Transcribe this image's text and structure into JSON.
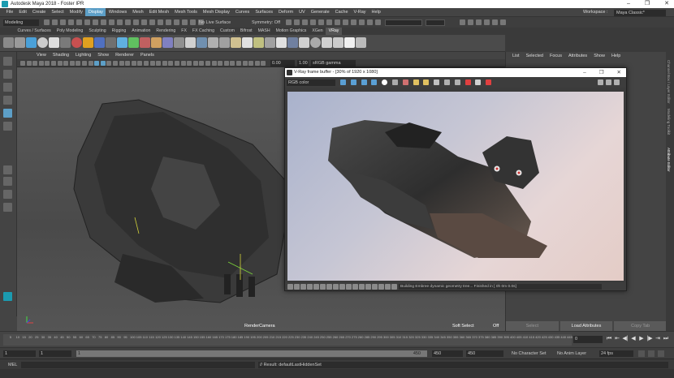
{
  "window": {
    "title": "Autodesk Maya 2018 - Foster IPR",
    "controls": [
      "–",
      "❐",
      "✕"
    ]
  },
  "menu": {
    "items": [
      "File",
      "Edit",
      "Create",
      "Select",
      "Modify",
      "Display",
      "Windows",
      "Mesh",
      "Edit Mesh",
      "Mesh Tools",
      "Mesh Display",
      "Curves",
      "Surfaces",
      "Deform",
      "UV",
      "Generate",
      "Cache",
      "V-Ray",
      "Help"
    ],
    "highlighted_index": 5,
    "workspace_label": "Workspace :",
    "workspace_value": "Maya Classic*"
  },
  "statusline": {
    "mode": "Modeling",
    "live_surface": "No Live Surface",
    "symmetry": "Symmetry: Off"
  },
  "shelf": {
    "tabs": [
      "Curves / Surfaces",
      "Poly Modeling",
      "Sculpting",
      "Rigging",
      "Animation",
      "Rendering",
      "FX",
      "FX Caching",
      "Custom",
      "Bifrost",
      "MASH",
      "Motion Graphics",
      "XGen",
      "VRay"
    ],
    "active_index": 13,
    "icon_colors": [
      "#8a8a8a",
      "#9a9a9a",
      "#4aa0d8",
      "#cccccc",
      "#dddddd",
      "#7a7a7a",
      "#c85050",
      "#e0a020",
      "#5070c0",
      "#707070",
      "#60b0e0",
      "#60c060",
      "#c06060",
      "#d0a060",
      "#8080c0",
      "#909090",
      "#d0d0d0",
      "#7090b0",
      "#b0b0b0",
      "#a0a0a0",
      "#d0c090",
      "#e0e0e0",
      "#c0c080",
      "#a0a0a0",
      "#e0e0e0",
      "#7080a0",
      "#d0d0d0",
      "#aaaaaa",
      "#d0d0d0",
      "#cccccc",
      "#f0f0f0",
      "#bbbbbb"
    ]
  },
  "panel": {
    "menu": [
      "View",
      "Shading",
      "Lighting",
      "Show",
      "Renderer",
      "Panels"
    ],
    "near_clip": "0.00",
    "gamma_value": "1.00",
    "color_space": "sRGB gamma",
    "camera_label": "RenderCamera"
  },
  "attribute_editor": {
    "menu": [
      "List",
      "Selected",
      "Focus",
      "Attributes",
      "Show",
      "Help"
    ],
    "buttons": [
      "Select",
      "Load Attributes",
      "Copy Tab"
    ],
    "side_tabs": [
      "Channel Box / Layer Editor",
      "Modeling Toolkit",
      "Attribute Editor"
    ]
  },
  "vray_fb": {
    "title": "V-Ray frame buffer - [30% of 1920 x 1080]",
    "channel": "RGB color",
    "status": "Building Embree dynamic geometry tree... Finished in [ 0h 0m 0.0s]",
    "tool_icon_colors": [
      "#5a9fd4",
      "#5a9fd4",
      "#5a9fd4",
      "#5a9fd4",
      "#ffffff",
      "#aaaaaa",
      "#d07070",
      "#e0c060",
      "#e0c060",
      "#c0c0c0",
      "#b0b0b0",
      "#b0b0b0",
      "#e04040",
      "#d0d0d0",
      "#e04040"
    ]
  },
  "viewport_hud": {
    "soft_select": "Soft Select",
    "soft_select_state": "Off"
  },
  "time": {
    "ruler_ticks": [
      "5",
      "10",
      "15",
      "20",
      "25",
      "30",
      "35",
      "40",
      "45",
      "50",
      "55",
      "60",
      "65",
      "70",
      "75",
      "80",
      "85",
      "90",
      "95",
      "100",
      "105",
      "110",
      "115",
      "120",
      "125",
      "130",
      "135",
      "140",
      "145",
      "150",
      "155",
      "160",
      "165",
      "170",
      "175",
      "180",
      "185",
      "190",
      "195",
      "200",
      "205",
      "210",
      "215",
      "220",
      "225",
      "230",
      "235",
      "240",
      "245",
      "250",
      "255",
      "260",
      "265",
      "270",
      "275",
      "280",
      "285",
      "290",
      "295",
      "300",
      "305",
      "310",
      "315",
      "320",
      "325",
      "330",
      "335",
      "340",
      "345",
      "350",
      "355",
      "360",
      "365",
      "370",
      "375",
      "380",
      "385",
      "390",
      "395",
      "400",
      "405",
      "410",
      "415",
      "420",
      "425",
      "430",
      "435",
      "440",
      "445"
    ],
    "current_frame": "0",
    "start": "1",
    "playback_start": "1",
    "range_start_handle": "1",
    "range_end_handle": "450",
    "playback_end": "450",
    "end": "450",
    "character_set": "No Character Set",
    "anim_layer": "No Anim Layer",
    "fps": "24 fps"
  },
  "command": {
    "mel": "MEL",
    "result": "// Result: defaultLastHiddenSet"
  }
}
